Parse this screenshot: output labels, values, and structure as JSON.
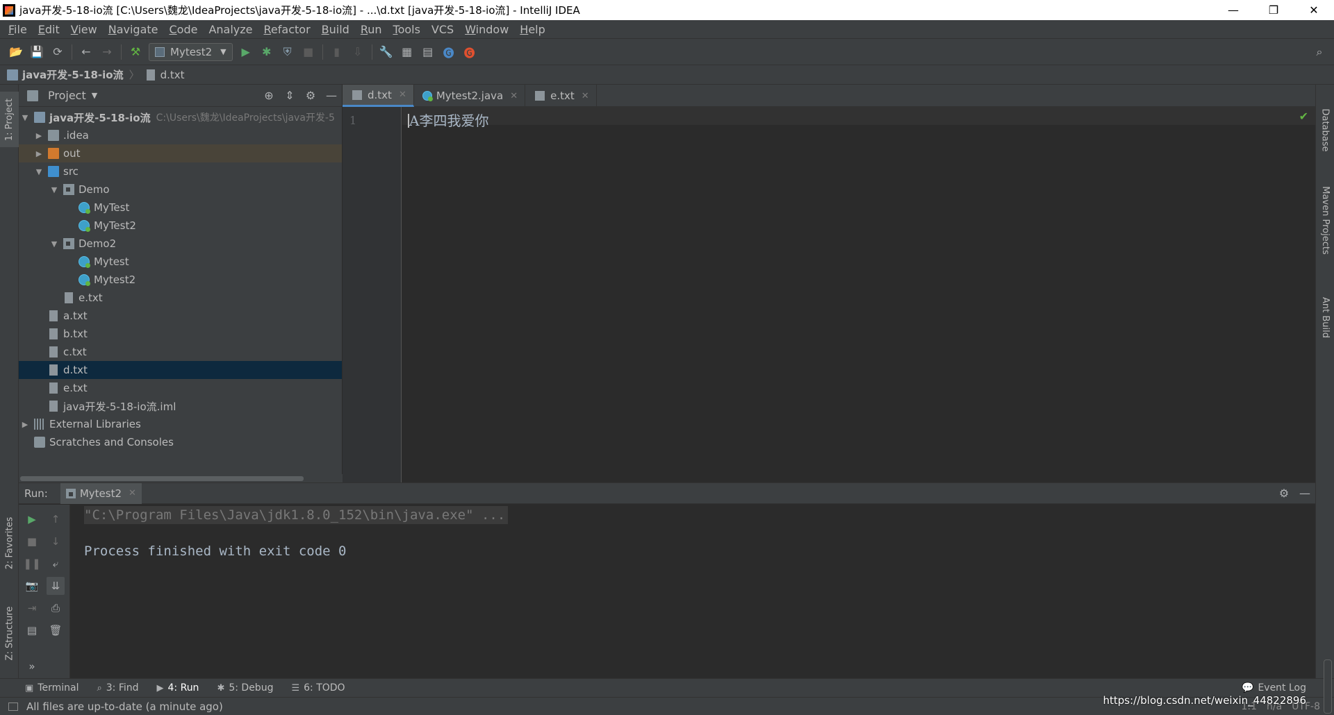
{
  "window": {
    "title": "java开发-5-18-io流 [C:\\Users\\魏龙\\IdeaProjects\\java开发-5-18-io流] - ...\\d.txt [java开发-5-18-io流] - IntelliJ IDEA",
    "minimize": "—",
    "restore": "❐",
    "close": "✕"
  },
  "menu": [
    {
      "u": "F",
      "rest": "ile"
    },
    {
      "u": "E",
      "rest": "dit"
    },
    {
      "u": "V",
      "rest": "iew"
    },
    {
      "u": "N",
      "rest": "avigate"
    },
    {
      "u": "C",
      "rest": "ode"
    },
    {
      "u": "",
      "rest": "Analyze"
    },
    {
      "u": "R",
      "rest": "efactor"
    },
    {
      "u": "B",
      "rest": "uild"
    },
    {
      "u": "R",
      "rest": "un",
      "pre": ""
    },
    {
      "u": "T",
      "rest": "ools"
    },
    {
      "u": "",
      "rest": "VCS"
    },
    {
      "u": "W",
      "rest": "indow"
    },
    {
      "u": "H",
      "rest": "elp"
    }
  ],
  "toolbar": {
    "run_config": "Mytest2"
  },
  "navbar": {
    "project": "java开发-5-18-io流",
    "file": "d.txt"
  },
  "left_strip": {
    "project_tab": "1: Project",
    "favorites_tab": "2: Favorites",
    "structure_tab": "Z: Structure"
  },
  "right_strip": {
    "database_tab": "Database",
    "maven_tab": "Maven Projects",
    "ant_tab": "Ant Build"
  },
  "project_panel": {
    "title": "Project",
    "root_name": "java开发-5-18-io流",
    "root_path": "C:\\Users\\魏龙\\IdeaProjects\\java开发-5",
    "items": {
      "idea": ".idea",
      "out": "out",
      "src": "src",
      "demo": "Demo",
      "mytest_a": "MyTest",
      "mytest2_a": "MyTest2",
      "demo2": "Demo2",
      "mytest_b": "Mytest",
      "mytest2_b": "Mytest2",
      "etxt_inner": "e.txt",
      "a": "a.txt",
      "b": "b.txt",
      "c": "c.txt",
      "d": "d.txt",
      "e": "e.txt",
      "iml": "java开发-5-18-io流.iml",
      "ext_libs": "External Libraries",
      "scratches": "Scratches and Consoles"
    }
  },
  "editor": {
    "tabs": [
      "d.txt",
      "Mytest2.java",
      "e.txt"
    ],
    "line_number": "1",
    "code": "A李四我爱你"
  },
  "run_panel": {
    "label": "Run:",
    "tab": "Mytest2",
    "command": "\"C:\\Program Files\\Java\\jdk1.8.0_152\\bin\\java.exe\" ...",
    "finished": "Process finished with exit code 0"
  },
  "tool_tabs": [
    {
      "icon": "▣",
      "label": "Terminal"
    },
    {
      "icon": "⌕",
      "label": "3: Find"
    },
    {
      "icon": "▶",
      "label": "4: Run"
    },
    {
      "icon": "✱",
      "label": "5: Debug"
    },
    {
      "icon": "☰",
      "label": "6: TODO"
    }
  ],
  "event_log": "Event Log",
  "status": {
    "message": "All files are up-to-date (a minute ago)",
    "position": "1:1",
    "separator": "n/a",
    "encoding": "UTF-8"
  },
  "watermark": "https://blog.csdn.net/weixin_44822896"
}
